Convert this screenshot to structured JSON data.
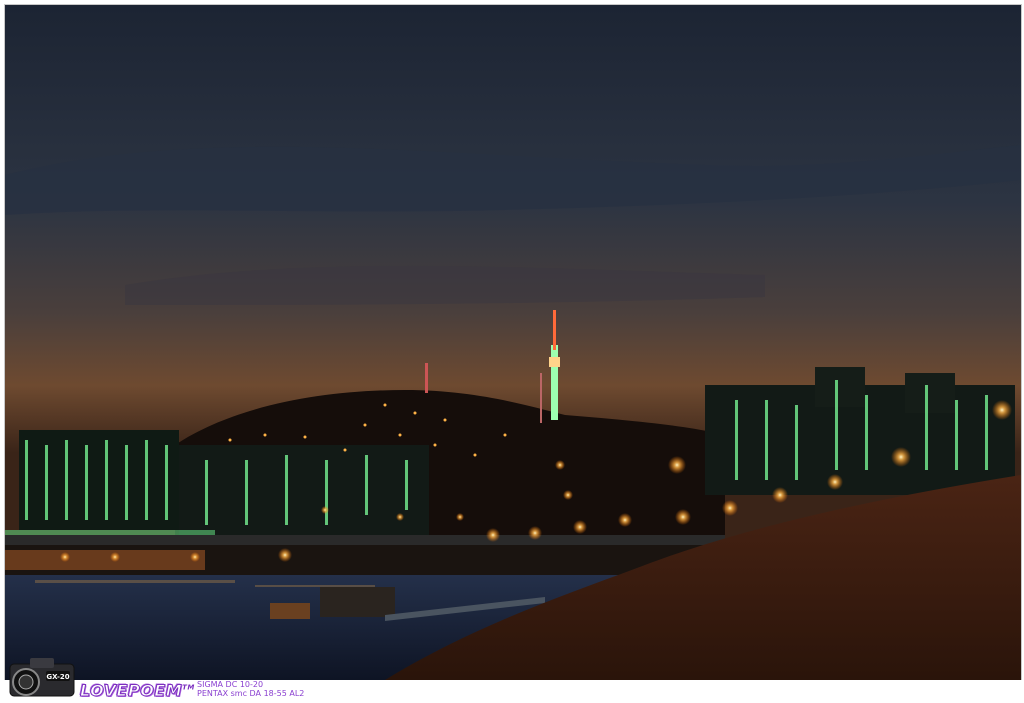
{
  "footer": {
    "camera_badge": "GX-20",
    "brand": "LOVEPOEM",
    "trademark": "TM",
    "lens_line_1": "SIGMA DC 10-20",
    "lens_line_2": "PENTAX smc DA 18-55 AL2"
  },
  "colors": {
    "sky_top": "#1c2433",
    "sky_horizon": "#7a4a2a",
    "brand_purple": "#7b2fbf",
    "light_orange": "#ffb347",
    "building_green": "#7dff9a"
  },
  "scene": {
    "icons": [
      "camera-icon",
      "tower-icon",
      "bridge",
      "river",
      "apartment-buildings",
      "street-lights"
    ]
  }
}
